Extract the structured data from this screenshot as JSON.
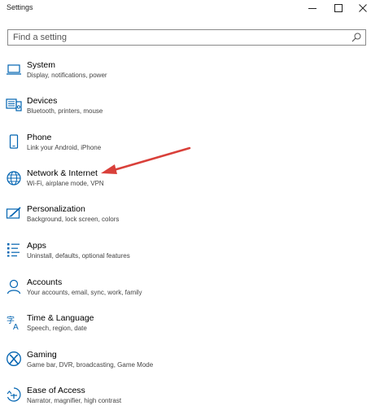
{
  "window": {
    "title": "Settings"
  },
  "search": {
    "placeholder": "Find a setting"
  },
  "items": [
    {
      "label": "System",
      "description": "Display, notifications, power",
      "icon": "laptop-icon"
    },
    {
      "label": "Devices",
      "description": "Bluetooth, printers, mouse",
      "icon": "keyboard-speaker-icon"
    },
    {
      "label": "Phone",
      "description": "Link your Android, iPhone",
      "icon": "phone-icon"
    },
    {
      "label": "Network & Internet",
      "description": "Wi-Fi, airplane mode, VPN",
      "icon": "globe-icon"
    },
    {
      "label": "Personalization",
      "description": "Background, lock screen, colors",
      "icon": "paint-screen-icon"
    },
    {
      "label": "Apps",
      "description": "Uninstall, defaults, optional features",
      "icon": "apps-list-icon"
    },
    {
      "label": "Accounts",
      "description": "Your accounts, email, sync, work, family",
      "icon": "person-icon"
    },
    {
      "label": "Time & Language",
      "description": "Speech, region, date",
      "icon": "language-icon"
    },
    {
      "label": "Gaming",
      "description": "Game bar, DVR, broadcasting, Game Mode",
      "icon": "xbox-icon"
    },
    {
      "label": "Ease of Access",
      "description": "Narrator, magnifier, high contrast",
      "icon": "ease-of-access-icon"
    }
  ],
  "colors": {
    "accent": "#0063b1",
    "annotation_arrow": "#d9403a"
  }
}
